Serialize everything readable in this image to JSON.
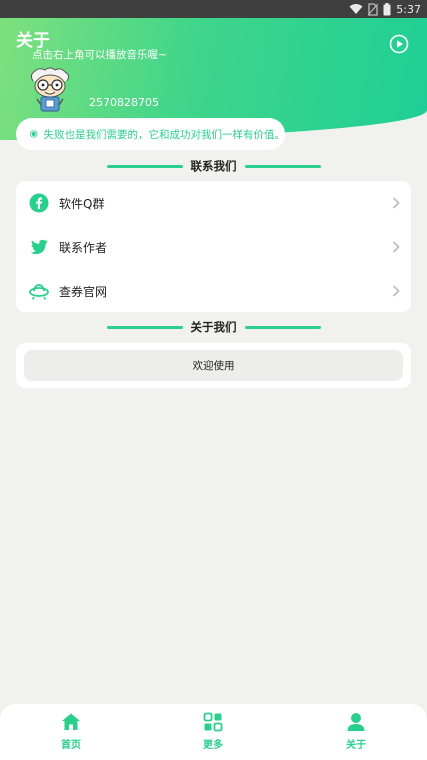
{
  "status_bar": {
    "time": "5:37",
    "icons": [
      "wifi-icon",
      "no-sim-icon",
      "battery-icon"
    ]
  },
  "header": {
    "title": "关于",
    "subtitle": "点击右上角可以播放音乐喔~",
    "user_id": "2570828705",
    "play_icon": "play-circle-icon"
  },
  "motto": {
    "text": "失败也是我们需要的，它和成功对我们一样有价值。"
  },
  "contact_section": {
    "heading": "联系我们",
    "items": [
      {
        "label": "软件Q群",
        "icon": "facebook-icon"
      },
      {
        "label": "联系作者",
        "icon": "twitter-icon"
      },
      {
        "label": "查券官网",
        "icon": "ufo-icon"
      }
    ]
  },
  "about_section": {
    "heading": "关于我们",
    "welcome_text": "欢迎使用"
  },
  "tabbar": {
    "tabs": [
      {
        "label": "首页",
        "icon": "home-icon"
      },
      {
        "label": "更多",
        "icon": "apps-icon"
      },
      {
        "label": "关于",
        "icon": "person-icon"
      }
    ]
  },
  "colors": {
    "accent": "#2bcf8d",
    "header_start": "#7ee07e",
    "header_end": "#1fcf96",
    "background": "#f1f2f0"
  }
}
